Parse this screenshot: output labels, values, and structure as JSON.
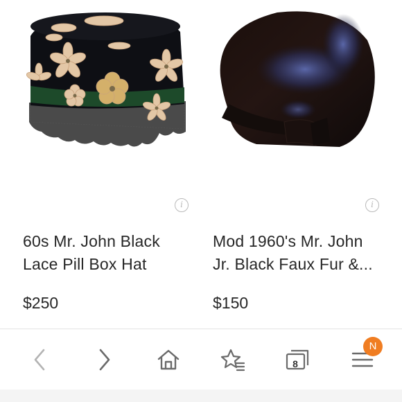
{
  "products": [
    {
      "title": "60s Mr. John Black Lace Pill Box Hat",
      "price": "$250",
      "image_icon": "pillbox-hat-image"
    },
    {
      "title": "Mod 1960's Mr. John Jr. Black Faux Fur &...",
      "price": "$150",
      "image_icon": "velvet-cap-image"
    }
  ],
  "info_glyph": "i",
  "toolbar": {
    "icons": [
      "back-icon",
      "forward-icon",
      "home-icon",
      "favorites-icon",
      "tabs-icon",
      "menu-icon"
    ],
    "tab_count": "8",
    "badge_letter": "N"
  },
  "colors": {
    "badge": "#f07d22",
    "icon_gray": "#7a7a7a",
    "text": "#262626"
  }
}
